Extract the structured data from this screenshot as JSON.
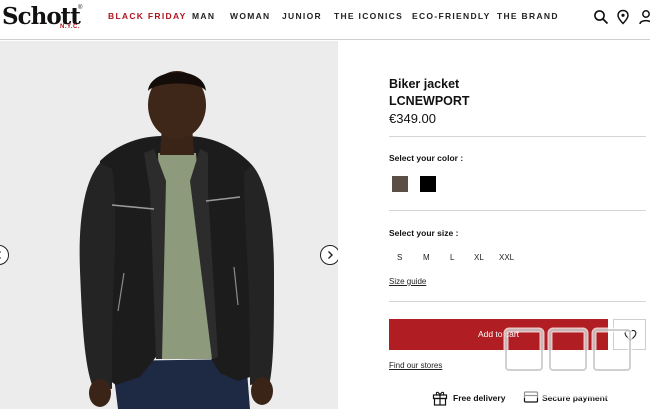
{
  "header": {
    "logo": {
      "brand": "Schott",
      "reg": "®",
      "city": "N.Y.C."
    },
    "nav": [
      "BLACK FRIDAY",
      "MAN",
      "WOMAN",
      "JUNIOR",
      "THE ICONICS",
      "ECO-FRIENDLY",
      "THE BRAND"
    ],
    "icons": [
      "search-icon",
      "location-pin-icon",
      "user-icon"
    ],
    "accent_color": "#b2141d"
  },
  "gallery": {
    "prev_icon": "chevron-left-icon",
    "next_icon": "chevron-right-icon"
  },
  "product": {
    "name": "Biker jacket",
    "model": "LCNEWPORT",
    "price": "€349.00",
    "color_label": "Select your color :",
    "colors": [
      {
        "name": "brown",
        "hex": "#5b4e45"
      },
      {
        "name": "black",
        "hex": "#000000"
      }
    ],
    "size_label": "Select your size :",
    "sizes": [
      "S",
      "M",
      "L",
      "XL",
      "XXL"
    ],
    "size_guide": "Size guide",
    "add_to_cart": "Add to cart",
    "cta_color": "#b01d23",
    "stores_link": "Find our stores",
    "features": [
      {
        "icon": "gift-icon",
        "label": "Free delivery"
      },
      {
        "icon": "secure-payment-icon",
        "label": "Secure payment"
      }
    ]
  }
}
